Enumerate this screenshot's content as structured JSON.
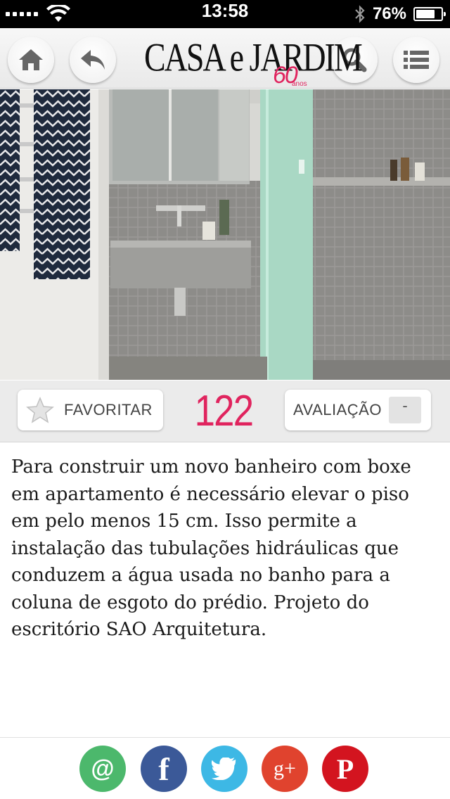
{
  "status_bar": {
    "time": "13:58",
    "battery_percent": "76%",
    "battery_level": 0.76,
    "icons": [
      "signal-icon",
      "wifi-icon",
      "bluetooth-icon",
      "battery-icon"
    ]
  },
  "header": {
    "brand_title": "CASA e JARDIM",
    "brand_badge": "60",
    "brand_badge_sub": "anos",
    "brand_color": "#e0245e",
    "buttons": [
      "home-icon",
      "back-icon",
      "search-icon",
      "menu-icon"
    ]
  },
  "actions": {
    "favorite_label": "FAVORITAR",
    "count": "122",
    "rating_label": "AVALIAÇÃO",
    "rating_value": "-"
  },
  "article": {
    "text": "Para construir um novo banheiro com boxe em apartamento é necessário elevar o piso em pelo menos 15 cm. Isso permite a instalação das tubulações hidráulicas que conduzem a água usada no banho para a coluna de esgoto do prédio. Projeto do escritório SAO Arquitetura."
  },
  "share": {
    "icons": [
      "email-icon",
      "facebook-icon",
      "twitter-icon",
      "google-plus-icon",
      "pinterest-icon"
    ],
    "email_glyph": "@",
    "facebook_glyph": "f",
    "google_plus_glyph": "g+",
    "pinterest_glyph": "P",
    "colors": [
      "#4cb86c",
      "#3b5998",
      "#3db8e5",
      "#e0432e",
      "#d3141f"
    ]
  }
}
